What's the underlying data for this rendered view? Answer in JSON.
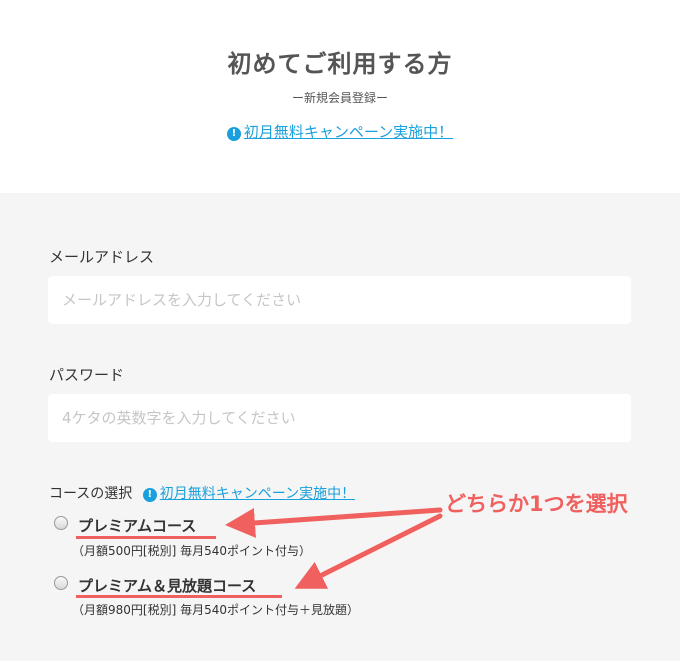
{
  "header": {
    "title": "初めてご利用する方",
    "subtitle": "ー新規会員登録ー",
    "campaign_link": "初月無料キャンペーン実施中！"
  },
  "form": {
    "email": {
      "label": "メールアドレス",
      "placeholder": "メールアドレスを入力してください",
      "value": ""
    },
    "password": {
      "label": "パスワード",
      "placeholder": "4ケタの英数字を入力してください",
      "value": ""
    },
    "course": {
      "label": "コースの選択",
      "campaign_link": "初月無料キャンペーン実施中！",
      "options": [
        {
          "name": "プレミアムコース",
          "description": "（月額500円[税別] 毎月540ポイント付与）",
          "selected": false
        },
        {
          "name": "プレミアム＆見放題コース",
          "description": "（月額980円[税別] 毎月540ポイント付与＋見放題）",
          "selected": false
        }
      ]
    }
  },
  "annotation": {
    "text": "どちらか1つを選択",
    "color": "#f0605e"
  },
  "colors": {
    "link": "#1aa0dc",
    "form_background": "#f5f5f5",
    "annotation": "#f0605e"
  },
  "icons": {
    "campaign": "exclamation-info-icon"
  }
}
